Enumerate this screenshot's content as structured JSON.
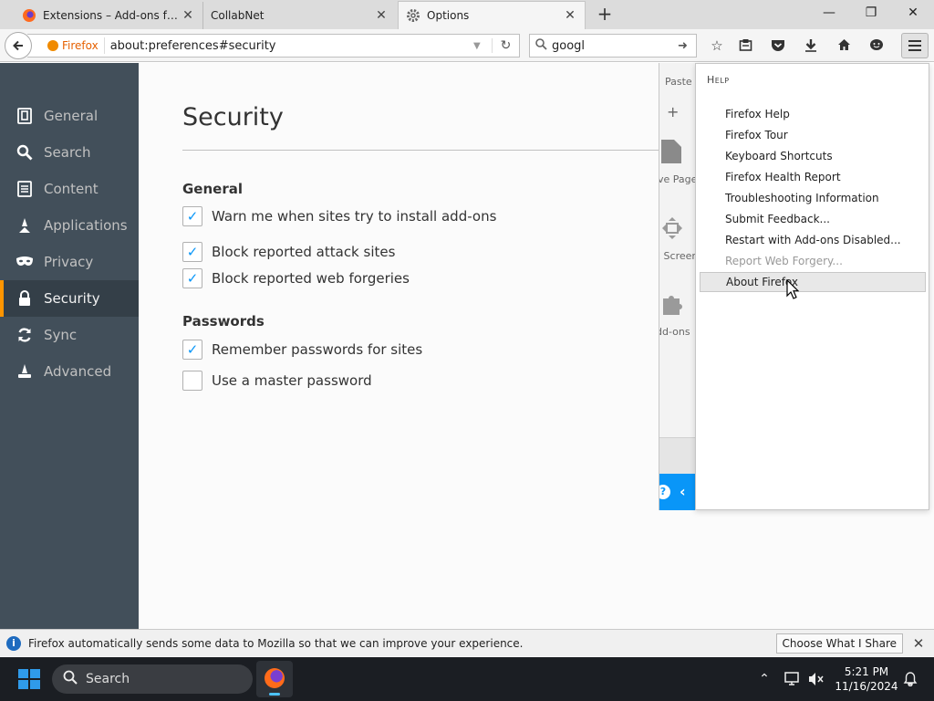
{
  "tabs": [
    {
      "title": "Extensions – Add-ons for ...",
      "active": false,
      "icon": "firefox-icon"
    },
    {
      "title": "CollabNet",
      "active": false,
      "icon": null
    },
    {
      "title": "Options",
      "active": true,
      "icon": "gear-icon"
    }
  ],
  "navbar": {
    "identity_label": "Firefox",
    "url": "about:preferences#security",
    "search_value": "googl"
  },
  "sidebar": {
    "items": [
      {
        "label": "General",
        "icon": "general-icon",
        "selected": false
      },
      {
        "label": "Search",
        "icon": "search-icon",
        "selected": false
      },
      {
        "label": "Content",
        "icon": "content-icon",
        "selected": false
      },
      {
        "label": "Applications",
        "icon": "applications-icon",
        "selected": false
      },
      {
        "label": "Privacy",
        "icon": "privacy-mask-icon",
        "selected": false
      },
      {
        "label": "Security",
        "icon": "security-lock-icon",
        "selected": true
      },
      {
        "label": "Sync",
        "icon": "sync-icon",
        "selected": false
      },
      {
        "label": "Advanced",
        "icon": "advanced-wizard-icon",
        "selected": false
      }
    ]
  },
  "page": {
    "title": "Security",
    "general_heading": "General",
    "general_options": [
      {
        "label": "Warn me when sites try to install add-ons",
        "checked": true
      },
      {
        "label": "Block reported attack sites",
        "checked": true
      },
      {
        "label": "Block reported web forgeries",
        "checked": true
      }
    ],
    "passwords_heading": "Passwords",
    "password_options": [
      {
        "label": "Remember passwords for sites",
        "checked": true
      },
      {
        "label": "Use a master password",
        "checked": false
      }
    ]
  },
  "main_panel": {
    "paste": "Paste",
    "save_page": "ve Page",
    "full_screen": "l Screen",
    "add_ons": "dd-ons"
  },
  "help_panel": {
    "heading": "Help",
    "items": [
      {
        "label": "Firefox Help",
        "disabled": false,
        "hover": false
      },
      {
        "label": "Firefox Tour",
        "disabled": false,
        "hover": false
      },
      {
        "label": "Keyboard Shortcuts",
        "disabled": false,
        "hover": false
      },
      {
        "label": "Firefox Health Report",
        "disabled": false,
        "hover": false
      },
      {
        "label": "Troubleshooting Information",
        "disabled": false,
        "hover": false
      },
      {
        "label": "Submit Feedback...",
        "disabled": false,
        "hover": false
      },
      {
        "label": "Restart with Add-ons Disabled...",
        "disabled": false,
        "hover": false
      },
      {
        "label": "Report Web Forgery...",
        "disabled": true,
        "hover": false
      },
      {
        "label": "About Firefox",
        "disabled": false,
        "hover": true
      }
    ]
  },
  "notification": {
    "text": "Firefox automatically sends some data to Mozilla so that we can improve your experience.",
    "button": "Choose What I Share"
  },
  "taskbar": {
    "search_placeholder": "Search",
    "time": "5:21 PM",
    "date": "11/16/2024"
  },
  "colors": {
    "sidebar_bg": "#424f5a",
    "selected_accent": "#ff9500",
    "checkbox_check": "#0996f8"
  }
}
